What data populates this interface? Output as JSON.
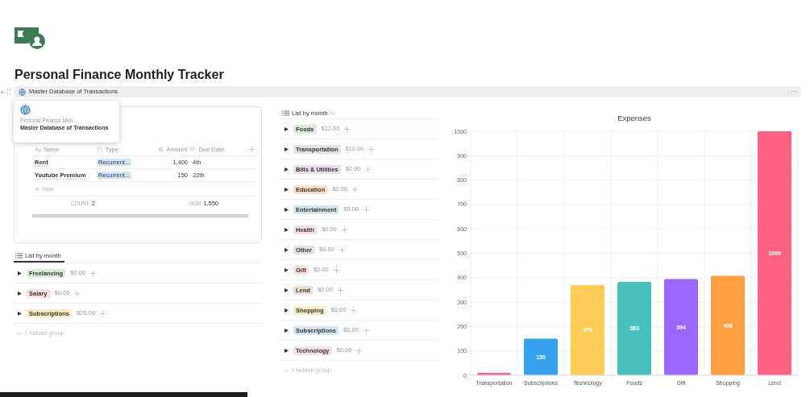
{
  "page": {
    "title": "Personal Finance Monthly Tracker"
  },
  "linked_database": {
    "title": "Master Database of Transactions",
    "more": "···"
  },
  "preview_popup": {
    "breadcrumb": "Personal Finance Mon...",
    "title": "Master Database of Transactions"
  },
  "table": {
    "columns": [
      "Name",
      "Type",
      "Amount",
      "Due Date"
    ],
    "rows": [
      {
        "name": "Rent",
        "type": "Recurrent...",
        "amount": "1,400",
        "due_date": "4th"
      },
      {
        "name": "Youtube Premium",
        "type": "Recurrent...",
        "amount": "150",
        "due_date": "22th"
      }
    ],
    "new_label": "New",
    "count_label": "COUNT",
    "count": "2",
    "sum_label": "SUM",
    "sum": "1,550"
  },
  "income_view": {
    "tab": "List by month",
    "groups": [
      {
        "label": "Freelancing",
        "amount": "$0.00",
        "color": "#dbeddb"
      },
      {
        "label": "Salary",
        "amount": "$0.00",
        "color": "#ffe2dd"
      },
      {
        "label": "Subscriptions",
        "amount": "$25.00",
        "color": "#fdecc8"
      }
    ],
    "hidden": "1 hidden group"
  },
  "expense_view": {
    "tab": "List by month",
    "groups": [
      {
        "label": "Foods",
        "amount": "$12.00",
        "color": "#dbeddb"
      },
      {
        "label": "Transportation",
        "amount": "$10.00",
        "color": "#e3e2e0"
      },
      {
        "label": "Bills & Utilities",
        "amount": "$0.00",
        "color": "#e8deee"
      },
      {
        "label": "Education",
        "amount": "$0.00",
        "color": "#fadec9"
      },
      {
        "label": "Entertainment",
        "amount": "$0.00",
        "color": "#d3e5ef"
      },
      {
        "label": "Health",
        "amount": "$0.00",
        "color": "#f5e0e9"
      },
      {
        "label": "Other",
        "amount": "$0.00",
        "color": "#e3e2e0"
      },
      {
        "label": "Gift",
        "amount": "$0.00",
        "color": "#ffe2dd"
      },
      {
        "label": "Lend",
        "amount": "$0.00",
        "color": "#eee0da"
      },
      {
        "label": "Shopping",
        "amount": "$0.00",
        "color": "#fdecc8"
      },
      {
        "label": "Subscriptions",
        "amount": "$0.00",
        "color": "#d3e5ef"
      },
      {
        "label": "Technology",
        "amount": "$0.00",
        "color": "#f5e0e9"
      }
    ],
    "hidden": "1 hidden group"
  },
  "expenses_chart": {
    "chart_data": {
      "type": "bar",
      "title": "Expenses",
      "categories": [
        "Transportation",
        "Subscriptions",
        "Technology",
        "Foods",
        "Gift",
        "Shopping",
        "Lend"
      ],
      "values": [
        10,
        150,
        370,
        383,
        394,
        408,
        1000
      ],
      "ylim": [
        0,
        1000
      ],
      "yticks": [
        0,
        100,
        200,
        300,
        400,
        500,
        600,
        700,
        800,
        900,
        1000
      ],
      "grid": true,
      "value_labels": [
        null,
        "150",
        "370",
        "383",
        "394",
        "408",
        "1000"
      ]
    }
  }
}
